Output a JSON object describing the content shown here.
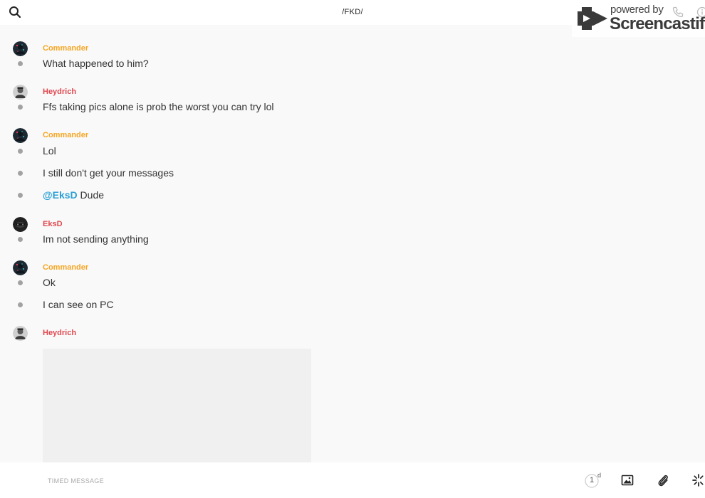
{
  "header": {
    "title": "/FKD/",
    "search_icon": "search-icon",
    "call_icon": "phone-icon",
    "info_icon": "info-icon"
  },
  "watermark": {
    "line1": "powered by",
    "line2": "Screencastify"
  },
  "senders": {
    "commander": "Commander",
    "heydrich": "Heydrich",
    "eksd": "EksD"
  },
  "colors": {
    "commander": "#f5a623",
    "heydrich": "#e0484f",
    "eksd": "#e0484f",
    "mention": "#2a9fd6"
  },
  "messages": [
    {
      "sender": "Commander",
      "text": "What happened to him?"
    },
    {
      "sender": "Heydrich",
      "text": "Ffs taking pics alone is prob the worst you can try lol"
    },
    {
      "sender": "Commander",
      "text": "Lol"
    },
    {
      "sender": "Commander",
      "text": "I still don't get your messages"
    },
    {
      "sender": "Commander",
      "mention": "@EksD",
      "text": " Dude"
    },
    {
      "sender": "EksD",
      "text": "Im not sending anything"
    },
    {
      "sender": "Commander",
      "text": "Ok"
    },
    {
      "sender": "Commander",
      "text": "I can see on PC"
    },
    {
      "sender": "Heydrich",
      "attachment": "image"
    }
  ],
  "composer": {
    "placeholder": "TIMED MESSAGE",
    "timer_value": "1",
    "timer_unit": "d",
    "image_icon": "image-icon",
    "attach_icon": "paperclip-icon",
    "sparkle_icon": "sparkle-icon"
  }
}
